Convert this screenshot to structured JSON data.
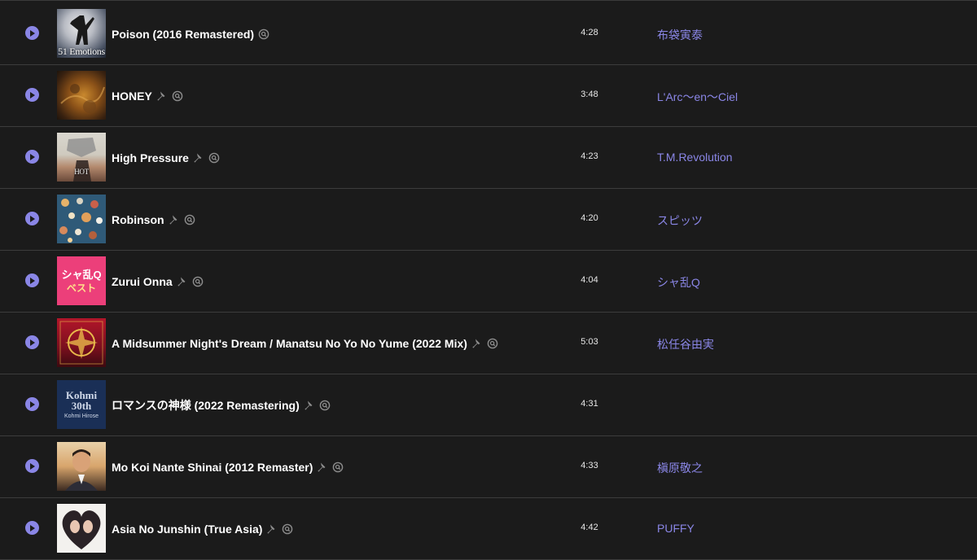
{
  "tracks": [
    {
      "title": "Poison (2016 Remastered)",
      "duration": "4:28",
      "artist": "布袋寅泰",
      "explicit_icon": false,
      "art_text": "51 Emotions"
    },
    {
      "title": "HONEY",
      "duration": "3:48",
      "artist": "L'Arc〜en〜Ciel",
      "explicit_icon": true,
      "art_text": ""
    },
    {
      "title": "High Pressure",
      "duration": "4:23",
      "artist": "T.M.Revolution",
      "explicit_icon": true,
      "art_text": "HOT"
    },
    {
      "title": "Robinson",
      "duration": "4:20",
      "artist": "スピッツ",
      "explicit_icon": true,
      "art_text": ""
    },
    {
      "title": "Zurui Onna",
      "duration": "4:04",
      "artist": "シャ乱Q",
      "explicit_icon": true,
      "art_text": "シャ乱Q"
    },
    {
      "title": "A Midsummer Night's Dream / Manatsu No Yo No Yume (2022 Mix)",
      "duration": "5:03",
      "artist": "松任谷由実",
      "explicit_icon": true,
      "art_text": ""
    },
    {
      "title": "ロマンスの神様 (2022 Remastering)",
      "duration": "4:31",
      "artist": "",
      "explicit_icon": true,
      "art_text": "Kohmi 30th"
    },
    {
      "title": "Mo Koi Nante Shinai (2012 Remaster)",
      "duration": "4:33",
      "artist": "槇原敬之",
      "explicit_icon": true,
      "art_text": ""
    },
    {
      "title": "Asia No Junshin (True Asia)",
      "duration": "4:42",
      "artist": "PUFFY",
      "explicit_icon": true,
      "art_text": ""
    }
  ],
  "art_subtext": {
    "zurui": "ベスト",
    "kohmi_sub": "Kohmi Hirose"
  },
  "colors": {
    "background": "#1b1b1b",
    "accent": "#8a86e6",
    "divider": "#3c3c3c",
    "icon_gray": "#8d8d8d"
  },
  "icons": {
    "play": "play-circle-icon",
    "pin": "pushpin-icon",
    "search": "search-magnify-icon"
  }
}
